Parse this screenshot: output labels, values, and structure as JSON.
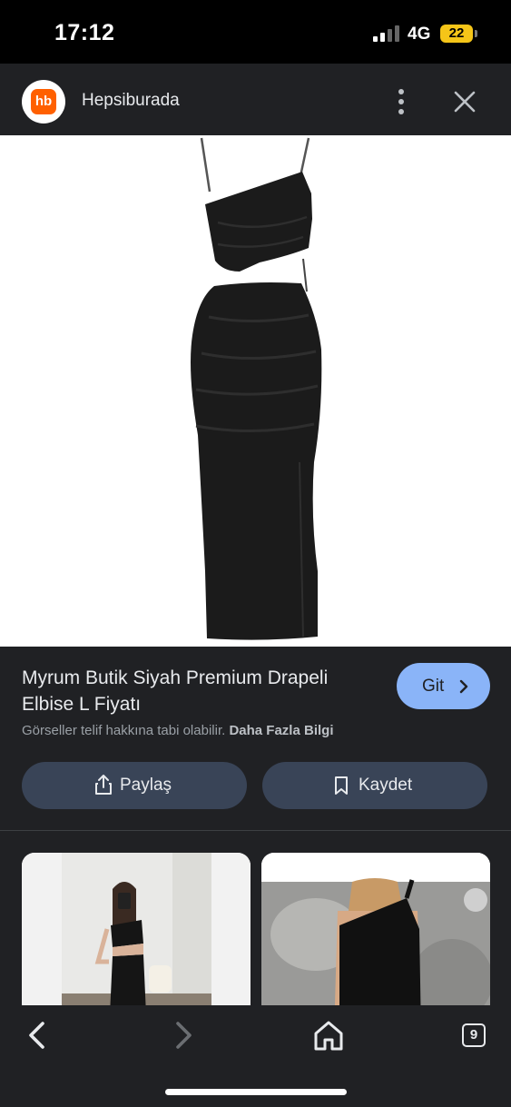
{
  "status": {
    "time": "17:12",
    "network": "4G",
    "battery": "22"
  },
  "header": {
    "logo_text": "hb",
    "site_name": "Hepsiburada"
  },
  "product": {
    "title": "Myrum Butik Siyah Premium Drapeli Elbise L Fiyatı",
    "visit_label": "Git",
    "copyright_note": "Görseller telif hakkına tabi olabilir.",
    "more_info": "Daha Fazla Bilgi"
  },
  "actions": {
    "share_label": "Paylaş",
    "save_label": "Kaydet"
  },
  "bottom_nav": {
    "tabs_count": "9"
  },
  "colors": {
    "accent": "#8ab4f8",
    "button_bg": "#394457",
    "background": "#202124",
    "brand": "#ff6000"
  },
  "icons": [
    "more-vert-icon",
    "close-icon",
    "share-icon",
    "bookmark-icon",
    "chevron-right-icon",
    "back-arrow-icon",
    "forward-arrow-icon",
    "home-icon",
    "tabs-icon"
  ]
}
